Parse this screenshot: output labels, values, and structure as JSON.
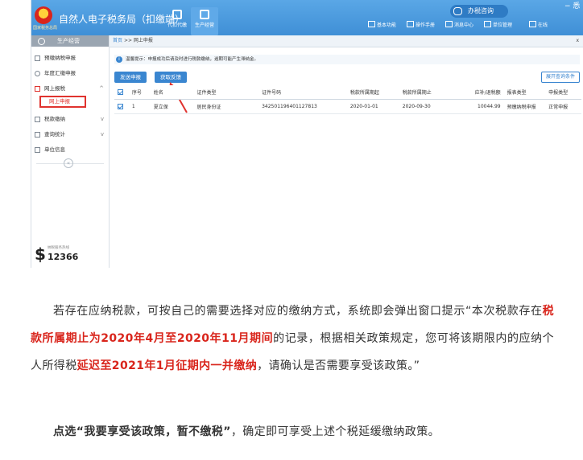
{
  "app": {
    "emblem_caption": "国家税务总局",
    "title": "自然人电子税务局（扣缴端）",
    "modules": [
      {
        "label": "代扣代缴",
        "icon": "building-icon"
      },
      {
        "label": "生产经营",
        "icon": "database-icon"
      }
    ],
    "toplinks": [
      {
        "label": "基本功能",
        "icon": "home-icon"
      },
      {
        "label": "操作手册",
        "icon": "book-icon"
      },
      {
        "label": "消息中心",
        "icon": "message-icon"
      },
      {
        "label": "单位管理",
        "icon": "building-icon"
      },
      {
        "label": "在线",
        "icon": "chat-icon"
      }
    ],
    "consult_label": "办税咨询",
    "window_controls": "− 悉"
  },
  "sidebar": {
    "header": "生产经营",
    "items": [
      {
        "label": "预缴纳税申报",
        "icon": "calendar-icon"
      },
      {
        "label": "年度汇缴申报",
        "icon": "clock-icon"
      },
      {
        "label": "网上报税",
        "icon": "send-icon",
        "expanded": true,
        "chevron": "^"
      },
      {
        "label": "税款缴纳",
        "icon": "money-icon",
        "chevron": "v"
      },
      {
        "label": "查询统计",
        "icon": "search-icon",
        "chevron": "v"
      },
      {
        "label": "单位信息",
        "icon": "list-icon"
      }
    ],
    "sub_item": "网上申报",
    "collapse_glyph": "«",
    "hotline": {
      "label": "纳税服务热线",
      "number": "12366"
    }
  },
  "breadcrumb": {
    "home": "首页",
    "sep": ">>",
    "current": "网上申报",
    "close": "x"
  },
  "tip": {
    "icon": "i",
    "text": "温馨提示：申报成功后请及时进行税款缴纳，逾期可能产生滞纳金。"
  },
  "buttons": {
    "send": "发送申报",
    "fetch": "获取反馈",
    "expand_query": "展开查询条件"
  },
  "table": {
    "headers": [
      "序号",
      "姓名",
      "证件类型",
      "证件号码",
      "税款所属期起",
      "税款所属期止",
      "应补/退税额",
      "报表类型",
      "申报类型"
    ],
    "rows": [
      [
        "1",
        "夏立保",
        "居民身份证",
        "342501196401127813",
        "2020-01-01",
        "2020-09-30",
        "10044.99",
        "预缴纳税申报",
        "正常申报"
      ]
    ]
  },
  "article": {
    "p1": [
      {
        "t": "若存在应纳税款，可按自己的需要选择对应的缴纳方式，系统即会弹出窗口提示“本次税款存在",
        "s": ""
      },
      {
        "t": "税款所属期止为2020年4月至2020年11月期间",
        "s": "red"
      },
      {
        "t": "的记录，根据相关政策规定，您可将该期限内的应纳个人所得税",
        "s": ""
      },
      {
        "t": "延迟至2021年1月征期内一并缴纳",
        "s": "red"
      },
      {
        "t": "，请确认是否需要享受该政策。”",
        "s": ""
      }
    ],
    "p2": [
      {
        "t": "点选“我要享受该政策，暂不缴税”",
        "s": "bold"
      },
      {
        "t": "，确定即可享受上述个税延缓缴纳政策。",
        "s": ""
      }
    ]
  }
}
